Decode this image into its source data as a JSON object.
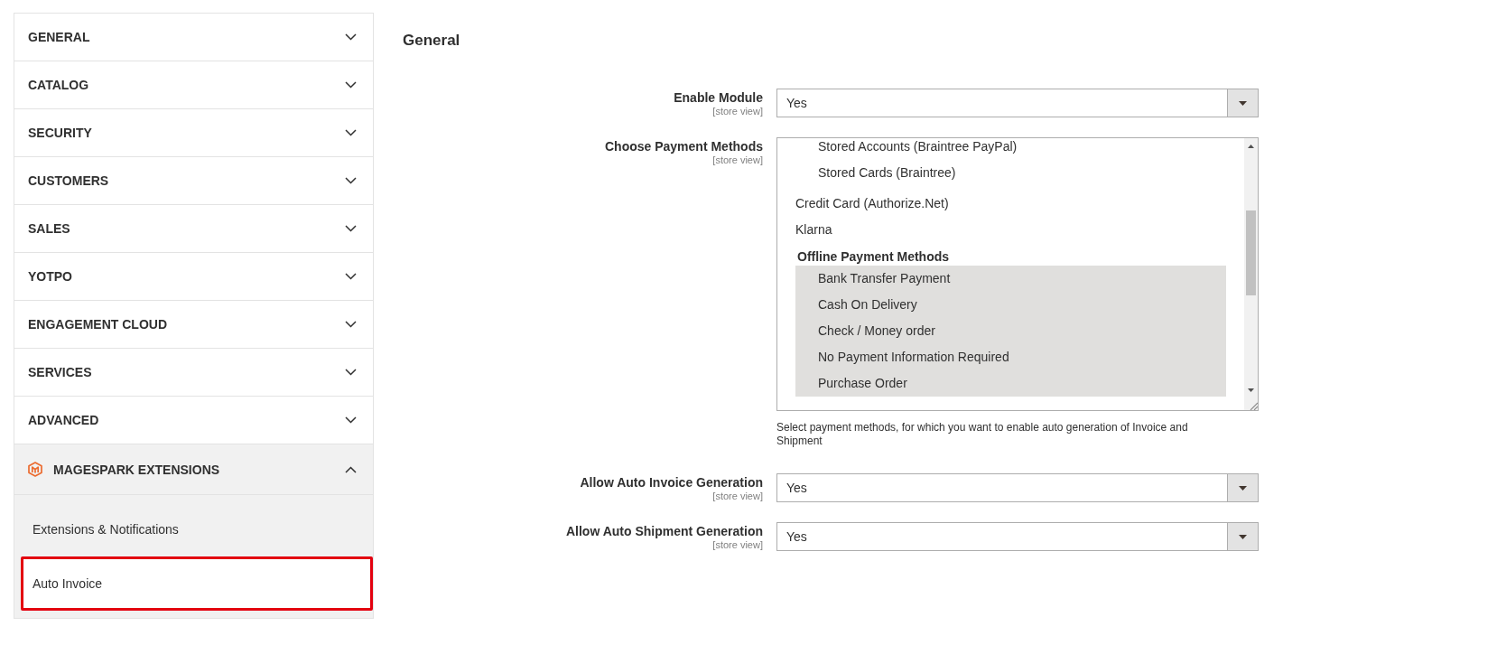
{
  "sidebar": {
    "sections": [
      {
        "label": "GENERAL",
        "kind": "core",
        "expanded": false
      },
      {
        "label": "CATALOG",
        "kind": "core",
        "expanded": false
      },
      {
        "label": "SECURITY",
        "kind": "core",
        "expanded": false
      },
      {
        "label": "CUSTOMERS",
        "kind": "core",
        "expanded": false
      },
      {
        "label": "SALES",
        "kind": "core",
        "expanded": false
      },
      {
        "label": "YOTPO",
        "kind": "core",
        "expanded": false
      },
      {
        "label": "ENGAGEMENT CLOUD",
        "kind": "core",
        "expanded": false
      },
      {
        "label": "SERVICES",
        "kind": "core",
        "expanded": false
      },
      {
        "label": "ADVANCED",
        "kind": "core",
        "expanded": false
      },
      {
        "label": "MAGESPARK EXTENSIONS",
        "kind": "extension",
        "expanded": true,
        "items": [
          {
            "label": "Extensions & Notifications",
            "selected": false,
            "highlighted": false
          },
          {
            "label": "Auto Invoice",
            "selected": true,
            "highlighted": true
          }
        ]
      }
    ]
  },
  "section": {
    "title": "General",
    "fields": [
      {
        "kind": "select",
        "label": "Enable Module",
        "scope": "[store view]",
        "value": "Yes"
      },
      {
        "kind": "multiselect",
        "label": "Choose Payment Methods",
        "scope": "[store view]",
        "options": [
          {
            "kind": "group",
            "children": [
              {
                "kind": "option",
                "label": "Stored Accounts (Braintree PayPal)",
                "selected": false
              },
              {
                "kind": "option",
                "label": "Stored Cards (Braintree)",
                "selected": false
              }
            ]
          },
          {
            "kind": "option",
            "label": "Credit Card (Authorize.Net)",
            "selected": false
          },
          {
            "kind": "option",
            "label": "Klarna",
            "selected": false
          },
          {
            "kind": "group",
            "label": "Offline Payment Methods",
            "children": [
              {
                "kind": "option",
                "label": "Bank Transfer Payment",
                "selected": true
              },
              {
                "kind": "option",
                "label": "Cash On Delivery",
                "selected": true
              },
              {
                "kind": "option",
                "label": "Check / Money order",
                "selected": true
              },
              {
                "kind": "option",
                "label": "No Payment Information Required",
                "selected": true
              },
              {
                "kind": "option",
                "label": "Purchase Order",
                "selected": true
              }
            ]
          }
        ],
        "note": "Select payment methods, for which you want to enable auto generation of Invoice and Shipment"
      },
      {
        "kind": "select",
        "label": "Allow Auto Invoice Generation",
        "scope": "[store view]",
        "value": "Yes"
      },
      {
        "kind": "select",
        "label": "Allow Auto Shipment Generation",
        "scope": "[store view]",
        "value": "Yes"
      }
    ]
  }
}
